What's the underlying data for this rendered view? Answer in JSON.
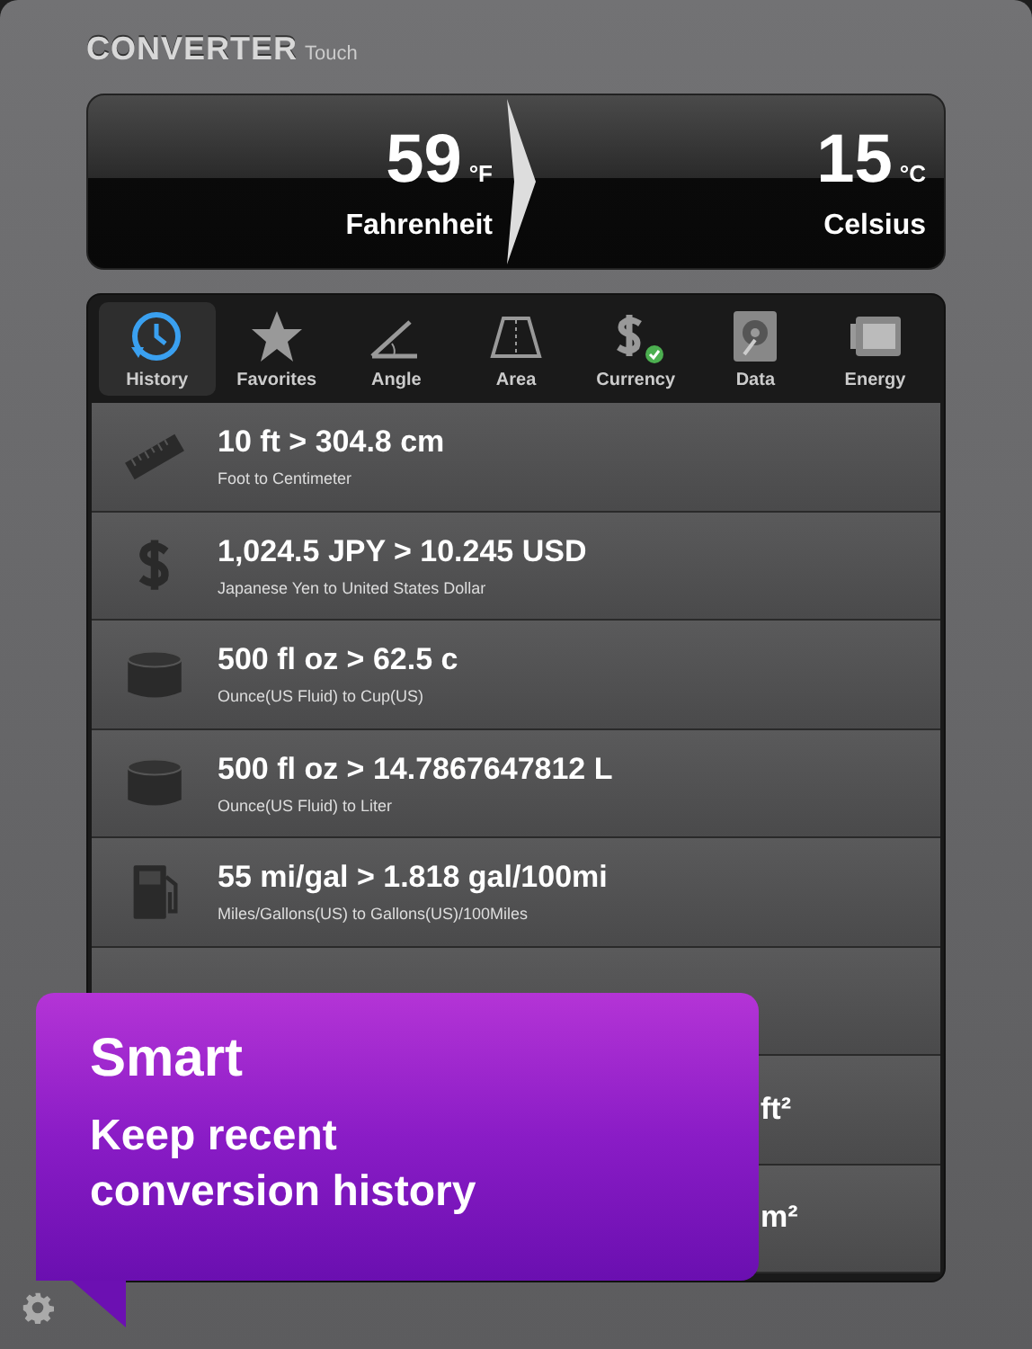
{
  "app_title": {
    "name": "CONVERTER",
    "suffix": "Touch"
  },
  "display": {
    "from": {
      "value": "59",
      "unit": "°F",
      "name": "Fahrenheit"
    },
    "to": {
      "value": "15",
      "unit": "°C",
      "name": "Celsius"
    }
  },
  "tabs": [
    {
      "label": "History",
      "selected": true
    },
    {
      "label": "Favorites",
      "selected": false
    },
    {
      "label": "Angle",
      "selected": false
    },
    {
      "label": "Area",
      "selected": false
    },
    {
      "label": "Currency",
      "selected": false
    },
    {
      "label": "Data",
      "selected": false
    },
    {
      "label": "Energy",
      "selected": false
    }
  ],
  "history": [
    {
      "kind": "full",
      "main": "10 ft > 304.8 cm",
      "sub": "Foot to Centimeter"
    },
    {
      "kind": "full",
      "main": "1,024.5 JPY > 10.245 USD",
      "sub": "Japanese Yen to United States Dollar"
    },
    {
      "kind": "full",
      "main": "500 fl oz > 62.5 c",
      "sub": "Ounce(US Fluid) to Cup(US)"
    },
    {
      "kind": "full",
      "main": "500 fl oz > 14.7867647812 L",
      "sub": "Ounce(US Fluid) to Liter"
    },
    {
      "kind": "full",
      "main": "55 mi/gal > 1.818 gal/100mi",
      "sub": "Miles/Gallons(US) to Gallons(US)/100Miles"
    },
    {
      "kind": "covered"
    },
    {
      "kind": "covered",
      "main": "ft²"
    },
    {
      "kind": "covered",
      "main": "m²"
    }
  ],
  "callout": {
    "title": "Smart",
    "text": "Keep recent conversion history"
  }
}
